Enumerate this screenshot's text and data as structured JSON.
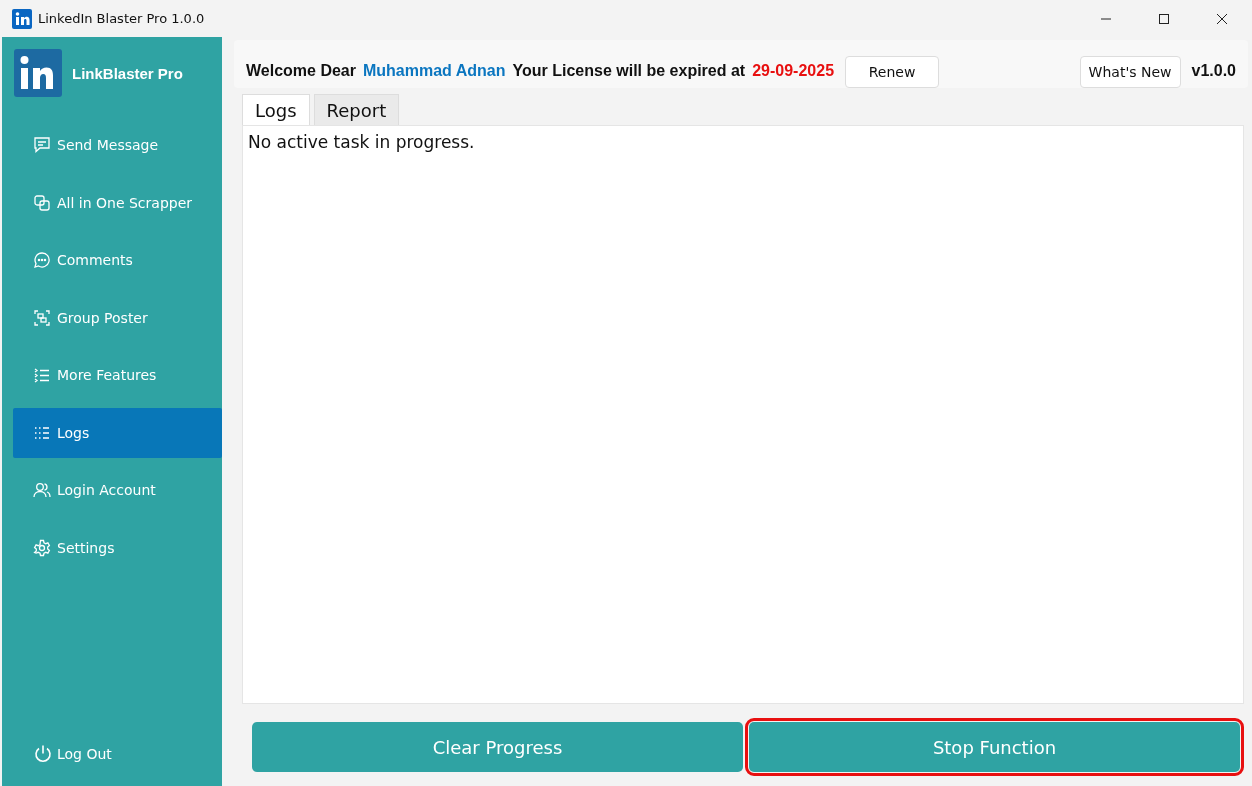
{
  "window": {
    "title": "LinkedIn Blaster Pro 1.0.0"
  },
  "sidebar": {
    "brand": "LinkBlaster Pro",
    "items": [
      {
        "label": "Send Message",
        "selected": false
      },
      {
        "label": "All in One Scrapper",
        "selected": false
      },
      {
        "label": "Comments",
        "selected": false
      },
      {
        "label": "Group Poster",
        "selected": false
      },
      {
        "label": "More Features",
        "selected": false
      },
      {
        "label": "Logs",
        "selected": true
      },
      {
        "label": "Login Account",
        "selected": false
      },
      {
        "label": "Settings",
        "selected": false
      }
    ],
    "logout": "Log Out"
  },
  "header": {
    "welcome": "Welcome Dear",
    "user": "Muhammad Adnan",
    "license": "Your License will be expired at",
    "expiry": "29-09-2025",
    "renew": "Renew",
    "whats_new": "What's New",
    "version": "v1.0.0"
  },
  "tabs": [
    {
      "label": "Logs",
      "selected": true
    },
    {
      "label": "Report",
      "selected": false
    }
  ],
  "log_text": "No active task in progress.",
  "buttons": [
    {
      "label": "Clear Progress",
      "highlighted": false
    },
    {
      "label": "Stop Function",
      "highlighted": true
    }
  ]
}
